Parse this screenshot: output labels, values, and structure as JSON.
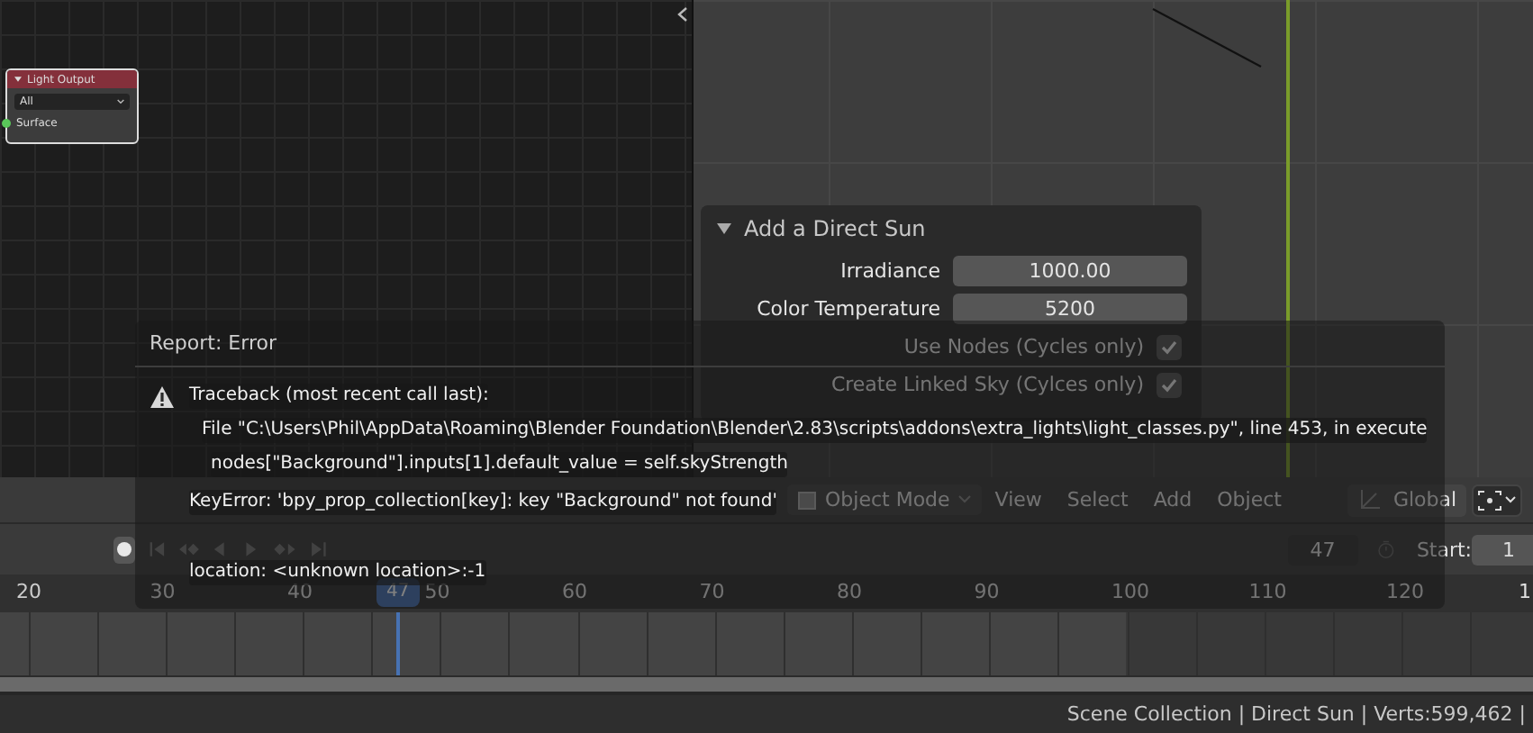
{
  "node_editor": {
    "node": {
      "title": "Light Output",
      "expanded": true,
      "target": "All",
      "socket": "Surface"
    }
  },
  "viewport": {
    "panel": {
      "title": "Add a Direct Sun",
      "expanded": true,
      "fields": [
        {
          "kind": "number",
          "label": "Irradiance",
          "value": "1000.00"
        },
        {
          "kind": "number",
          "label": "Color Temperature",
          "value": "5200"
        },
        {
          "kind": "checkbox",
          "label": "Use Nodes (Cycles only)",
          "checked": true
        },
        {
          "kind": "checkbox",
          "label": "Create Linked Sky (Cylces only)",
          "checked": true
        }
      ]
    }
  },
  "header": {
    "mode": "Object Mode",
    "menus": [
      "View",
      "Select",
      "Add",
      "Object"
    ],
    "orientation": "Global"
  },
  "timeline": {
    "current_frame": "47",
    "playhead_frame": "47",
    "start_label": "Start:",
    "start": "1",
    "ruler": [
      "20",
      "30",
      "40",
      "50",
      "60",
      "70",
      "80",
      "90",
      "100",
      "110",
      "120",
      "1"
    ]
  },
  "report": {
    "title": "Report: Error",
    "lines": [
      {
        "kind": "heading",
        "text": "Traceback (most recent call last):"
      },
      {
        "kind": "frame",
        "text": "File \"C:\\Users\\Phil\\AppData\\Roaming\\Blender Foundation\\Blender\\2.83\\scripts\\addons\\extra_lights\\light_classes.py\", line 453, in execute"
      },
      {
        "kind": "code",
        "text": "nodes[\"Background\"].inputs[1].default_value = self.skyStrength"
      },
      {
        "kind": "error",
        "text": "KeyError: 'bpy_prop_collection[key]: key \"Background\" not found'"
      },
      {
        "kind": "location",
        "text": "location: <unknown location>:-1"
      }
    ]
  },
  "status_bar": "Scene Collection | Direct Sun | Verts:599,462 |"
}
